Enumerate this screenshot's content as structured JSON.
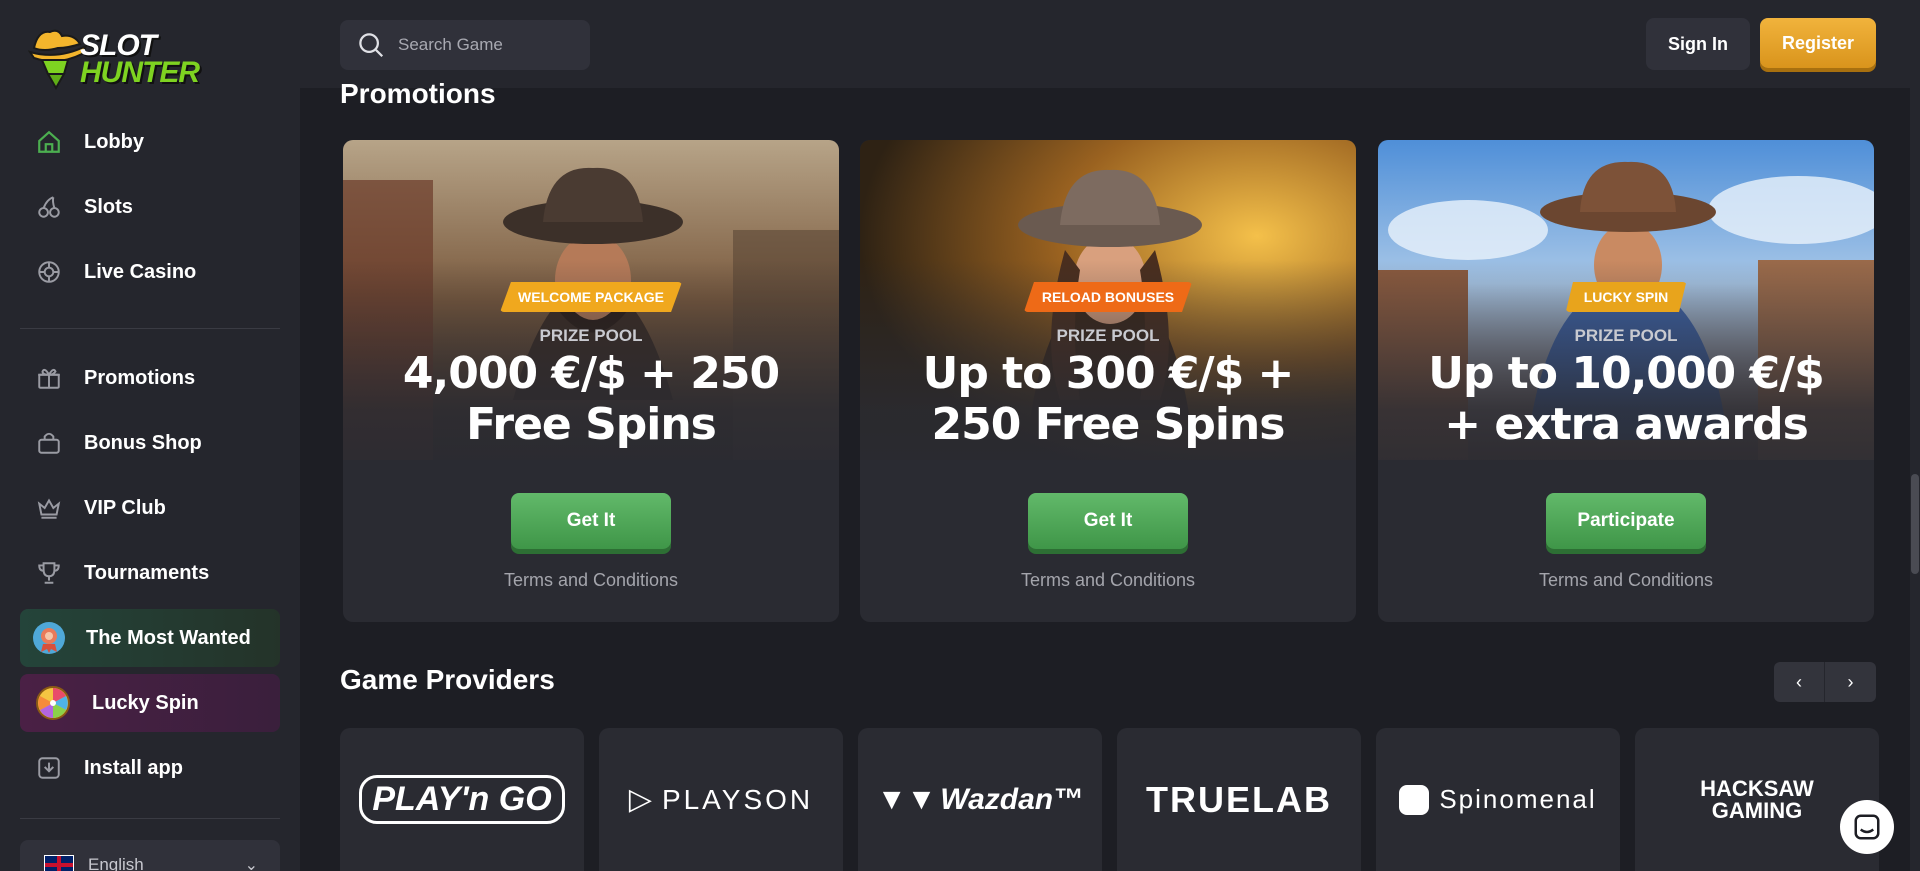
{
  "brand": {
    "line1": "SLOT",
    "line2": "HUNTER"
  },
  "search": {
    "placeholder": "Search Game"
  },
  "header": {
    "signin": "Sign In",
    "register": "Register"
  },
  "sidebar": {
    "items": [
      {
        "label": "Lobby",
        "icon": "home-icon"
      },
      {
        "label": "Slots",
        "icon": "cherry-icon"
      },
      {
        "label": "Live Casino",
        "icon": "chip-icon"
      },
      {
        "label": "Promotions",
        "icon": "gift-icon"
      },
      {
        "label": "Bonus Shop",
        "icon": "shopping-bag-icon"
      },
      {
        "label": "VIP Club",
        "icon": "crown-icon"
      },
      {
        "label": "Tournaments",
        "icon": "trophy-icon"
      },
      {
        "label": "The Most Wanted",
        "icon": "badge-icon"
      },
      {
        "label": "Lucky Spin",
        "icon": "wheel-icon"
      },
      {
        "label": "Install app",
        "icon": "download-icon"
      }
    ],
    "language": "English"
  },
  "promotions": {
    "title": "Promotions",
    "cards": [
      {
        "badge": "WELCOME PACKAGE",
        "prize_label": "PRIZE POOL",
        "title_l1": "4,000 €/$ + 250",
        "title_l2": "Free Spins",
        "button": "Get It",
        "terms": "Terms and Conditions",
        "badge_color": "#f0a81e"
      },
      {
        "badge": "RELOAD BONUSES",
        "prize_label": "PRIZE POOL",
        "title_l1": "Up to 300 €/$ +",
        "title_l2": "250 Free Spins",
        "button": "Get It",
        "terms": "Terms and Conditions",
        "badge_color": "#ee6a17"
      },
      {
        "badge": "LUCKY SPIN",
        "prize_label": "PRIZE POOL",
        "title_l1": "Up to 10,000 €/$",
        "title_l2": "+ extra awards",
        "button": "Participate",
        "terms": "Terms and Conditions",
        "badge_color": "#e8a41c"
      }
    ]
  },
  "providers": {
    "title": "Game Providers",
    "prev": "‹",
    "next": "›",
    "items": [
      "PLAY'n GO",
      "PLAYSON",
      "Wazdan™",
      "TRUELAB",
      "Spinomenal",
      "HACKSAW GAMING"
    ]
  },
  "colors": {
    "accent_green": "#4caf50",
    "accent_gold": "#f1b33c",
    "bg": "#1d1e24",
    "panel": "#25262d"
  }
}
